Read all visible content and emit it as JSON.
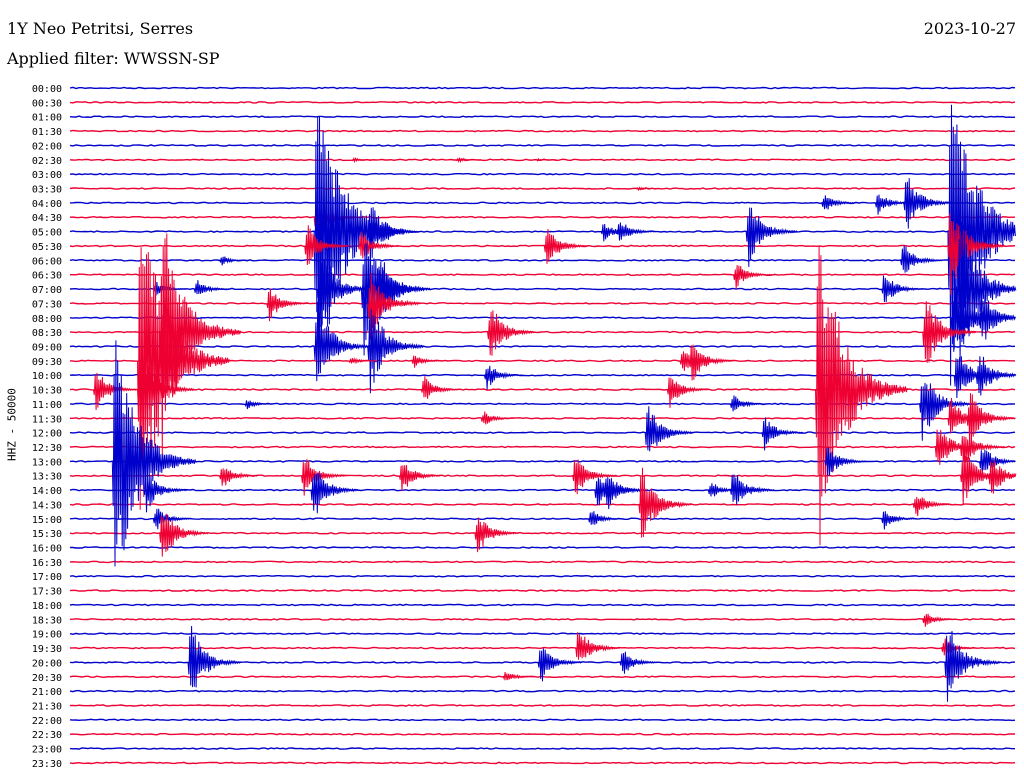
{
  "header": {
    "station": "1Y Neo Petritsi, Serres",
    "date": "2023-10-27",
    "filter": "Applied filter: WWSSN-SP"
  },
  "chart_data": {
    "type": "line",
    "title": "1Y Neo Petritsi, Serres",
    "ylabel": "HHZ - 50000",
    "row_labels": [
      "00:00",
      "00:30",
      "01:00",
      "01:30",
      "02:00",
      "02:30",
      "03:00",
      "03:30",
      "04:00",
      "04:30",
      "05:00",
      "05:30",
      "06:00",
      "06:30",
      "07:00",
      "07:30",
      "08:00",
      "08:30",
      "09:00",
      "09:30",
      "10:00",
      "10:30",
      "11:00",
      "11:30",
      "12:00",
      "12:30",
      "13:00",
      "13:30",
      "14:00",
      "14:30",
      "15:00",
      "15:30",
      "16:00",
      "16:30",
      "17:00",
      "17:30",
      "18:00",
      "18:30",
      "19:00",
      "19:30",
      "20:00",
      "20:30",
      "21:00",
      "21:30",
      "22:00",
      "22:30",
      "23:00",
      "23:30"
    ],
    "colors": [
      "#0000cc",
      "#ee0033"
    ],
    "x_range_minutes": [
      0,
      30
    ],
    "events": [
      {
        "row": 5,
        "x": 9.1,
        "amp": 3
      },
      {
        "row": 5,
        "x": 12.4,
        "amp": 4
      },
      {
        "row": 5,
        "x": 14.9,
        "amp": 2
      },
      {
        "row": 7,
        "x": 18.1,
        "amp": 3
      },
      {
        "row": 8,
        "x": 24.0,
        "amp": 15
      },
      {
        "row": 8,
        "x": 25.7,
        "amp": 18
      },
      {
        "row": 8,
        "x": 26.6,
        "amp": 40
      },
      {
        "row": 9,
        "x": 7.9,
        "amp": 30
      },
      {
        "row": 10,
        "x": 7.9,
        "amp": 190
      },
      {
        "row": 10,
        "x": 9.6,
        "amp": 40
      },
      {
        "row": 10,
        "x": 10.0,
        "amp": 20
      },
      {
        "row": 10,
        "x": 17.0,
        "amp": 15
      },
      {
        "row": 10,
        "x": 17.5,
        "amp": 20
      },
      {
        "row": 10,
        "x": 21.6,
        "amp": 45
      },
      {
        "row": 10,
        "x": 28.0,
        "amp": 200
      },
      {
        "row": 11,
        "x": 7.6,
        "amp": 30
      },
      {
        "row": 11,
        "x": 9.3,
        "amp": 25
      },
      {
        "row": 11,
        "x": 15.2,
        "amp": 30
      },
      {
        "row": 11,
        "x": 28.0,
        "amp": 60
      },
      {
        "row": 12,
        "x": 4.9,
        "amp": 8
      },
      {
        "row": 12,
        "x": 26.5,
        "amp": 25
      },
      {
        "row": 13,
        "x": 21.2,
        "amp": 20
      },
      {
        "row": 14,
        "x": 2.8,
        "amp": 12
      },
      {
        "row": 14,
        "x": 4.1,
        "amp": 15
      },
      {
        "row": 14,
        "x": 8.0,
        "amp": 60
      },
      {
        "row": 14,
        "x": 9.4,
        "amp": 80
      },
      {
        "row": 14,
        "x": 9.9,
        "amp": 50
      },
      {
        "row": 14,
        "x": 25.9,
        "amp": 25
      },
      {
        "row": 14,
        "x": 28.3,
        "amp": 100
      },
      {
        "row": 15,
        "x": 6.4,
        "amp": 25
      },
      {
        "row": 15,
        "x": 9.6,
        "amp": 50
      },
      {
        "row": 16,
        "x": 28.1,
        "amp": 60
      },
      {
        "row": 16,
        "x": 29.0,
        "amp": 40
      },
      {
        "row": 17,
        "x": 3.0,
        "amp": 150
      },
      {
        "row": 17,
        "x": 13.4,
        "amp": 40
      },
      {
        "row": 17,
        "x": 27.2,
        "amp": 50
      },
      {
        "row": 18,
        "x": 7.9,
        "amp": 60
      },
      {
        "row": 18,
        "x": 9.6,
        "amp": 60
      },
      {
        "row": 19,
        "x": 2.3,
        "amp": 200
      },
      {
        "row": 19,
        "x": 9.0,
        "amp": 6
      },
      {
        "row": 19,
        "x": 11.0,
        "amp": 10
      },
      {
        "row": 19,
        "x": 19.5,
        "amp": 20
      },
      {
        "row": 19,
        "x": 19.8,
        "amp": 30
      },
      {
        "row": 20,
        "x": 13.3,
        "amp": 20
      },
      {
        "row": 20,
        "x": 28.2,
        "amp": 40
      },
      {
        "row": 20,
        "x": 28.9,
        "amp": 35
      },
      {
        "row": 21,
        "x": 0.9,
        "amp": 30
      },
      {
        "row": 21,
        "x": 2.3,
        "amp": 60
      },
      {
        "row": 21,
        "x": 11.3,
        "amp": 20
      },
      {
        "row": 21,
        "x": 19.1,
        "amp": 25
      },
      {
        "row": 21,
        "x": 23.8,
        "amp": 200
      },
      {
        "row": 22,
        "x": 5.7,
        "amp": 8
      },
      {
        "row": 22,
        "x": 21.1,
        "amp": 15
      },
      {
        "row": 22,
        "x": 27.1,
        "amp": 50
      },
      {
        "row": 23,
        "x": 13.2,
        "amp": 12
      },
      {
        "row": 23,
        "x": 28.0,
        "amp": 30
      },
      {
        "row": 23,
        "x": 28.6,
        "amp": 40
      },
      {
        "row": 24,
        "x": 18.4,
        "amp": 40
      },
      {
        "row": 24,
        "x": 22.1,
        "amp": 25
      },
      {
        "row": 25,
        "x": 27.6,
        "amp": 35
      },
      {
        "row": 25,
        "x": 28.4,
        "amp": 30
      },
      {
        "row": 26,
        "x": 1.5,
        "amp": 160
      },
      {
        "row": 26,
        "x": 24.1,
        "amp": 25
      },
      {
        "row": 26,
        "x": 29.0,
        "amp": 25
      },
      {
        "row": 27,
        "x": 4.9,
        "amp": 20
      },
      {
        "row": 27,
        "x": 7.5,
        "amp": 30
      },
      {
        "row": 27,
        "x": 10.6,
        "amp": 25
      },
      {
        "row": 27,
        "x": 16.1,
        "amp": 30
      },
      {
        "row": 27,
        "x": 28.4,
        "amp": 40
      },
      {
        "row": 27,
        "x": 29.3,
        "amp": 30
      },
      {
        "row": 28,
        "x": 2.5,
        "amp": 30
      },
      {
        "row": 28,
        "x": 7.8,
        "amp": 40
      },
      {
        "row": 28,
        "x": 16.8,
        "amp": 30
      },
      {
        "row": 28,
        "x": 17.1,
        "amp": 30
      },
      {
        "row": 28,
        "x": 20.4,
        "amp": 15
      },
      {
        "row": 28,
        "x": 21.1,
        "amp": 30
      },
      {
        "row": 29,
        "x": 18.2,
        "amp": 50
      },
      {
        "row": 29,
        "x": 26.9,
        "amp": 20
      },
      {
        "row": 30,
        "x": 2.8,
        "amp": 20
      },
      {
        "row": 30,
        "x": 16.6,
        "amp": 15
      },
      {
        "row": 30,
        "x": 25.9,
        "amp": 15
      },
      {
        "row": 31,
        "x": 3.0,
        "amp": 40
      },
      {
        "row": 31,
        "x": 13.0,
        "amp": 30
      },
      {
        "row": 37,
        "x": 27.2,
        "amp": 12
      },
      {
        "row": 39,
        "x": 16.2,
        "amp": 30
      },
      {
        "row": 39,
        "x": 27.8,
        "amp": 15
      },
      {
        "row": 40,
        "x": 3.9,
        "amp": 50
      },
      {
        "row": 40,
        "x": 15.0,
        "amp": 30
      },
      {
        "row": 40,
        "x": 17.6,
        "amp": 20
      },
      {
        "row": 40,
        "x": 27.9,
        "amp": 55
      },
      {
        "row": 41,
        "x": 13.9,
        "amp": 10
      }
    ]
  }
}
